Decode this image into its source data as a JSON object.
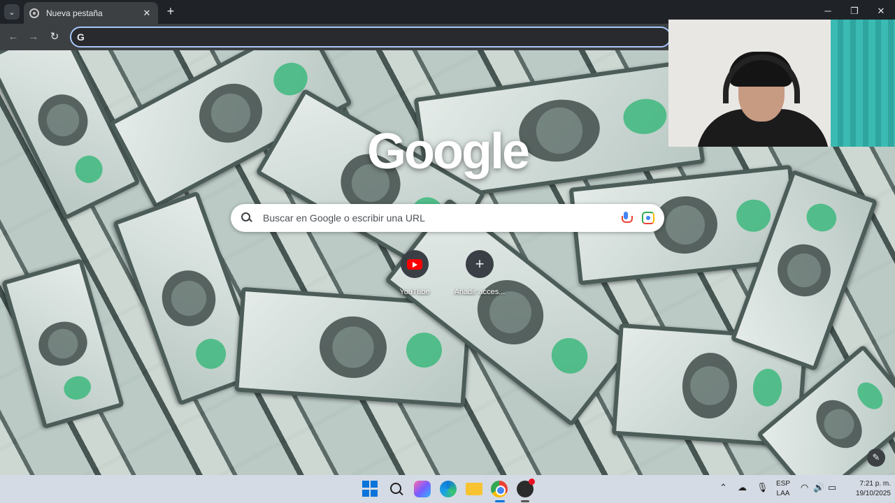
{
  "browser": {
    "tab": {
      "title": "Nueva pestaña",
      "close": "✕"
    },
    "new_tab": "+",
    "tab_search": "⌄",
    "window_controls": {
      "minimize": "─",
      "maximize": "❐",
      "close": "✕"
    },
    "nav": {
      "back": "←",
      "forward": "→",
      "reload": "↻"
    },
    "omnibox": {
      "value": "",
      "icon_letter": "G"
    }
  },
  "newtab": {
    "logo": "Google",
    "search": {
      "placeholder": "Buscar en Google o escribir una URL"
    },
    "shortcuts": [
      {
        "label": "YouTube",
        "icon": "youtube-icon"
      },
      {
        "label": "Añadir acces...",
        "icon": "plus-icon",
        "glyph": "+"
      }
    ],
    "customize": "✎"
  },
  "taskbar": {
    "apps": [
      "windows-start-icon",
      "search-icon",
      "copilot-icon",
      "edge-icon",
      "file-explorer-icon",
      "chrome-icon",
      "obs-icon"
    ],
    "tray": {
      "chevron": "⌃",
      "language_line1": "ESP",
      "language_line2": "LAA",
      "wifi": "◠",
      "volume": "🔊",
      "battery": "▭"
    },
    "clock": {
      "time": "7:21 p. m.",
      "date": "19/10/2025"
    }
  },
  "colors": {
    "tabstrip": "#1f2328",
    "toolbar": "#3c4043",
    "omnibox_focus": "#a8c7fa",
    "taskbar": "#d5dbe4",
    "youtube_red": "#ff0000"
  }
}
